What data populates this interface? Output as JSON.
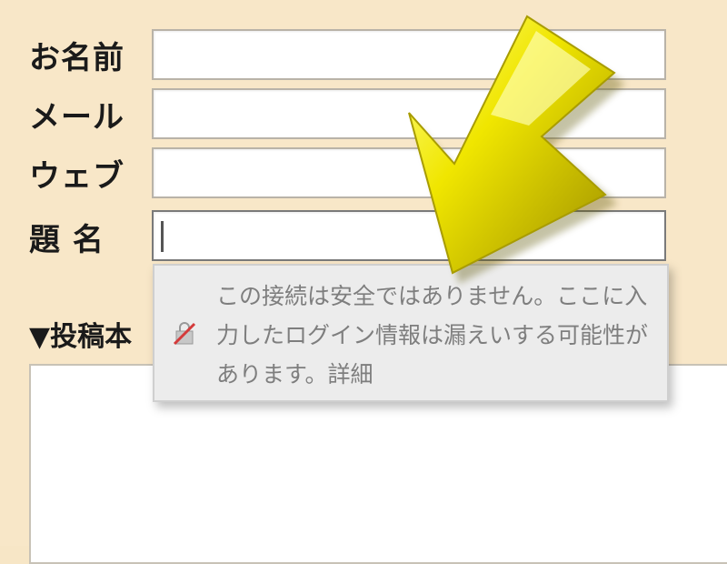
{
  "form": {
    "name_label": "お名前",
    "mail_label": "メール",
    "web_label": "ウェブ",
    "subject_label": "題 名",
    "body_label": "▼投稿本"
  },
  "security_popup": {
    "message": "この接続は安全ではありません。ここに入力したログイン情報は漏えいする可能性があります。詳細"
  },
  "icons": {
    "lock": "broken-lock-icon",
    "arrow": "arrow-icon"
  },
  "colors": {
    "background": "#f8e7c8",
    "arrow": "#d9d100"
  }
}
